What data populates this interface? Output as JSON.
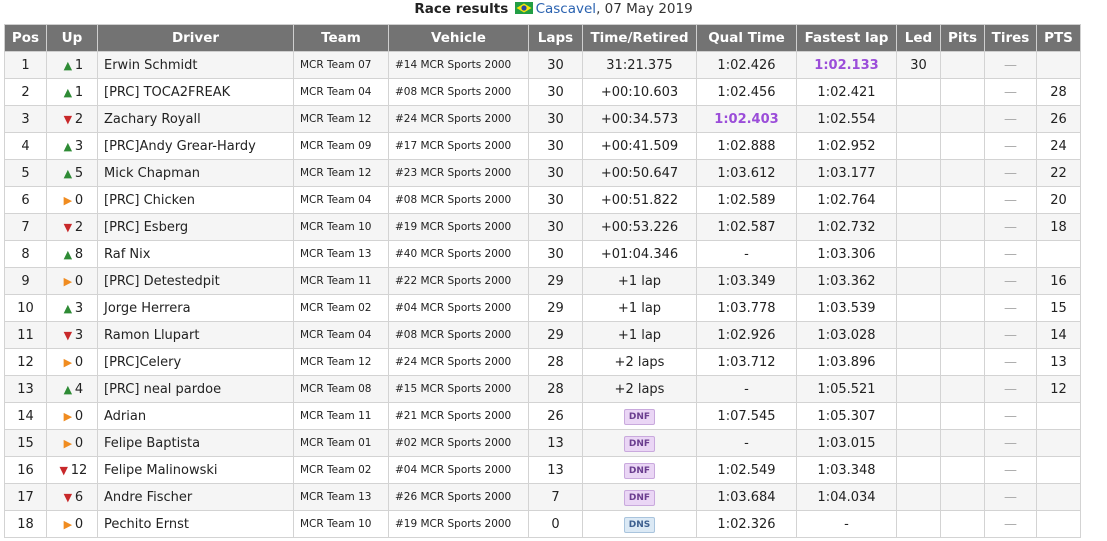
{
  "caption": {
    "title": "Race results",
    "track": "Cascavel",
    "date": ", 07 May 2019",
    "flag_icon": "brazil-flag-icon"
  },
  "headers": [
    "Pos",
    "Up",
    "Driver",
    "Team",
    "Vehicle",
    "Laps",
    "Time/Retired",
    "Qual Time",
    "Fastest lap",
    "Led",
    "Pits",
    "Tires",
    "PTS"
  ],
  "rows": [
    {
      "pos": "1",
      "dir": "up",
      "chg": "1",
      "driver": "Erwin Schmidt",
      "team": "MCR Team 07",
      "vehicle": "#14 MCR Sports 2000",
      "laps": "30",
      "time": "31:21.375",
      "qual": "1:02.426",
      "fast": "1:02.133",
      "fast_best": true,
      "led": "30",
      "pits": "",
      "tires": "—",
      "pts": ""
    },
    {
      "pos": "2",
      "dir": "up",
      "chg": "1",
      "driver": "[PRC] TOCA2FREAK",
      "team": "MCR Team 04",
      "vehicle": "#08 MCR Sports 2000",
      "laps": "30",
      "time": "+00:10.603",
      "qual": "1:02.456",
      "fast": "1:02.421",
      "led": "",
      "pits": "",
      "tires": "—",
      "pts": "28"
    },
    {
      "pos": "3",
      "dir": "down",
      "chg": "2",
      "driver": "Zachary Royall",
      "team": "MCR Team 12",
      "vehicle": "#24 MCR Sports 2000",
      "laps": "30",
      "time": "+00:34.573",
      "qual": "1:02.403",
      "qual_best": true,
      "fast": "1:02.554",
      "led": "",
      "pits": "",
      "tires": "—",
      "pts": "26"
    },
    {
      "pos": "4",
      "dir": "up",
      "chg": "3",
      "driver": "[PRC]Andy Grear-Hardy",
      "team": "MCR Team 09",
      "vehicle": "#17 MCR Sports 2000",
      "laps": "30",
      "time": "+00:41.509",
      "qual": "1:02.888",
      "fast": "1:02.952",
      "led": "",
      "pits": "",
      "tires": "—",
      "pts": "24"
    },
    {
      "pos": "5",
      "dir": "up",
      "chg": "5",
      "driver": "Mick Chapman",
      "team": "MCR Team 12",
      "vehicle": "#23 MCR Sports 2000",
      "laps": "30",
      "time": "+00:50.647",
      "qual": "1:03.612",
      "fast": "1:03.177",
      "led": "",
      "pits": "",
      "tires": "—",
      "pts": "22"
    },
    {
      "pos": "6",
      "dir": "same",
      "chg": "0",
      "driver": "[PRC] Chicken",
      "team": "MCR Team 04",
      "vehicle": "#08 MCR Sports 2000",
      "laps": "30",
      "time": "+00:51.822",
      "qual": "1:02.589",
      "fast": "1:02.764",
      "led": "",
      "pits": "",
      "tires": "—",
      "pts": "20"
    },
    {
      "pos": "7",
      "dir": "down",
      "chg": "2",
      "driver": "[PRC] Esberg",
      "team": "MCR Team 10",
      "vehicle": "#19 MCR Sports 2000",
      "laps": "30",
      "time": "+00:53.226",
      "qual": "1:02.587",
      "fast": "1:02.732",
      "led": "",
      "pits": "",
      "tires": "—",
      "pts": "18"
    },
    {
      "pos": "8",
      "dir": "up",
      "chg": "8",
      "driver": "Raf Nix",
      "team": "MCR Team 13",
      "vehicle": "#40 MCR Sports 2000",
      "laps": "30",
      "time": "+01:04.346",
      "qual": "-",
      "fast": "1:03.306",
      "led": "",
      "pits": "",
      "tires": "—",
      "pts": ""
    },
    {
      "pos": "9",
      "dir": "same",
      "chg": "0",
      "driver": "[PRC] Detestedpit",
      "team": "MCR Team 11",
      "vehicle": "#22 MCR Sports 2000",
      "laps": "29",
      "time": "+1 lap",
      "qual": "1:03.349",
      "fast": "1:03.362",
      "led": "",
      "pits": "",
      "tires": "—",
      "pts": "16"
    },
    {
      "pos": "10",
      "dir": "up",
      "chg": "3",
      "driver": "Jorge Herrera",
      "team": "MCR Team 02",
      "vehicle": "#04 MCR Sports 2000",
      "laps": "29",
      "time": "+1 lap",
      "qual": "1:03.778",
      "fast": "1:03.539",
      "led": "",
      "pits": "",
      "tires": "—",
      "pts": "15"
    },
    {
      "pos": "11",
      "dir": "down",
      "chg": "3",
      "driver": "Ramon Llupart",
      "team": "MCR Team 04",
      "vehicle": "#08 MCR Sports 2000",
      "laps": "29",
      "time": "+1 lap",
      "qual": "1:02.926",
      "fast": "1:03.028",
      "led": "",
      "pits": "",
      "tires": "—",
      "pts": "14"
    },
    {
      "pos": "12",
      "dir": "same",
      "chg": "0",
      "driver": "[PRC]Celery",
      "team": "MCR Team 12",
      "vehicle": "#24 MCR Sports 2000",
      "laps": "28",
      "time": "+2 laps",
      "qual": "1:03.712",
      "fast": "1:03.896",
      "led": "",
      "pits": "",
      "tires": "—",
      "pts": "13"
    },
    {
      "pos": "13",
      "dir": "up",
      "chg": "4",
      "driver": "[PRC] neal pardoe",
      "team": "MCR Team 08",
      "vehicle": "#15 MCR Sports 2000",
      "laps": "28",
      "time": "+2 laps",
      "qual": "-",
      "fast": "1:05.521",
      "led": "",
      "pits": "",
      "tires": "—",
      "pts": "12"
    },
    {
      "pos": "14",
      "dir": "same",
      "chg": "0",
      "driver": "Adrian",
      "team": "MCR Team 11",
      "vehicle": "#21 MCR Sports 2000",
      "laps": "26",
      "time": "DNF",
      "time_badge": "dnf",
      "qual": "1:07.545",
      "fast": "1:05.307",
      "led": "",
      "pits": "",
      "tires": "—",
      "pts": ""
    },
    {
      "pos": "15",
      "dir": "same",
      "chg": "0",
      "driver": "Felipe Baptista",
      "team": "MCR Team 01",
      "vehicle": "#02 MCR Sports 2000",
      "laps": "13",
      "time": "DNF",
      "time_badge": "dnf",
      "qual": "-",
      "fast": "1:03.015",
      "led": "",
      "pits": "",
      "tires": "—",
      "pts": ""
    },
    {
      "pos": "16",
      "dir": "down",
      "chg": "12",
      "driver": "Felipe Malinowski",
      "team": "MCR Team 02",
      "vehicle": "#04 MCR Sports 2000",
      "laps": "13",
      "time": "DNF",
      "time_badge": "dnf",
      "qual": "1:02.549",
      "fast": "1:03.348",
      "led": "",
      "pits": "",
      "tires": "—",
      "pts": ""
    },
    {
      "pos": "17",
      "dir": "down",
      "chg": "6",
      "driver": "Andre Fischer",
      "team": "MCR Team 13",
      "vehicle": "#26 MCR Sports 2000",
      "laps": "7",
      "time": "DNF",
      "time_badge": "dnf",
      "qual": "1:03.684",
      "fast": "1:04.034",
      "led": "",
      "pits": "",
      "tires": "—",
      "pts": ""
    },
    {
      "pos": "18",
      "dir": "same",
      "chg": "0",
      "driver": "Pechito Ernst",
      "team": "MCR Team 10",
      "vehicle": "#19 MCR Sports 2000",
      "laps": "0",
      "time": "DNS",
      "time_badge": "dns",
      "qual": "1:02.326",
      "fast": "-",
      "led": "",
      "pits": "",
      "tires": "—",
      "pts": ""
    }
  ]
}
